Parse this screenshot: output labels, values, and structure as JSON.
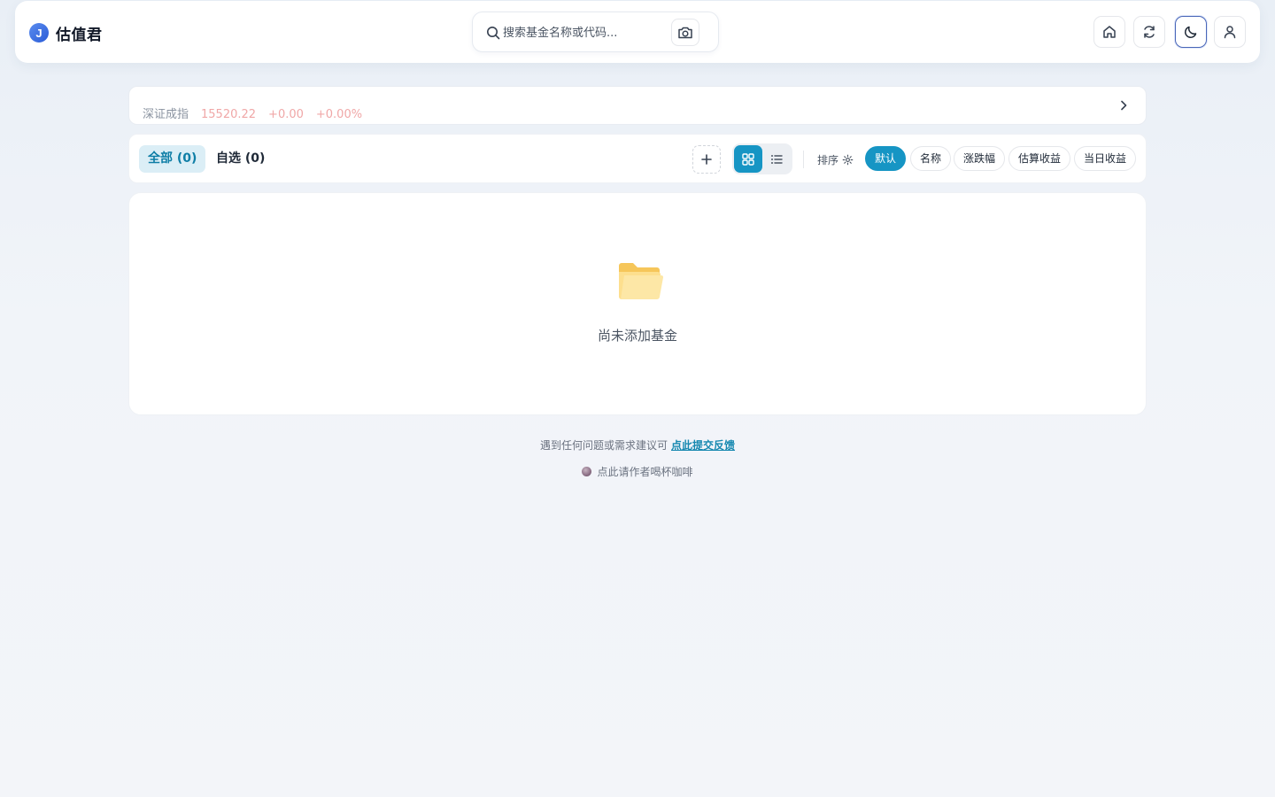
{
  "app": {
    "title": "估值君",
    "logo_letter": "J"
  },
  "search": {
    "placeholder": "搜索基金名称或代码..."
  },
  "header_buttons": [
    {
      "icon": "home-icon"
    },
    {
      "icon": "refresh-icon"
    },
    {
      "icon": "moon-icon",
      "active": true
    },
    {
      "icon": "user-icon"
    }
  ],
  "ticker": {
    "name": "深证成指",
    "value": "15520.22",
    "change": "+0.00",
    "change_pct": "+0.00%"
  },
  "tabs": [
    {
      "label": "全部 (0)",
      "active": true
    },
    {
      "label": "自选 (0)",
      "active": false
    }
  ],
  "sort": {
    "label": "排序",
    "options": [
      {
        "label": "默认",
        "active": true
      },
      {
        "label": "名称",
        "active": false
      },
      {
        "label": "涨跌幅",
        "active": false
      },
      {
        "label": "估算收益",
        "active": false
      },
      {
        "label": "当日收益",
        "active": false
      }
    ]
  },
  "empty_state": {
    "text": "尚未添加基金"
  },
  "footer": {
    "prompt": "遇到任何问题或需求建议可",
    "link": "点此提交反馈",
    "coffee": "点此请作者喝杯咖啡"
  },
  "colors": {
    "accent": "#1695c4",
    "tab_active_bg": "#dbeef6",
    "tab_active_text": "#0e7ea6",
    "folder": "#fcd97a"
  }
}
